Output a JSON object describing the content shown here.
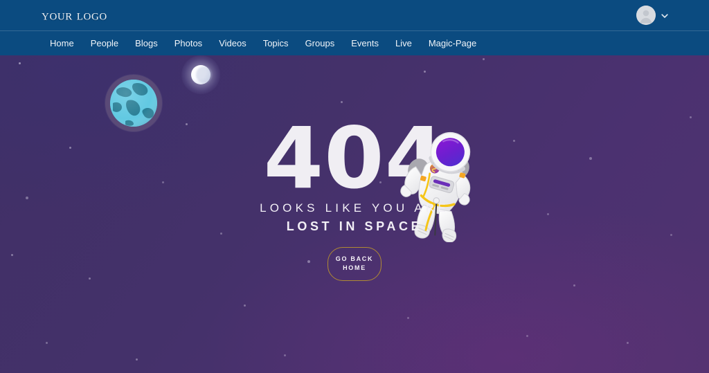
{
  "brand": {
    "logo_text": "Your logo",
    "account_icon": "user-avatar-placeholder",
    "chevron_icon": "chevron-down-icon"
  },
  "nav": {
    "items": [
      {
        "label": "Home"
      },
      {
        "label": "People"
      },
      {
        "label": "Blogs"
      },
      {
        "label": "Photos"
      },
      {
        "label": "Videos"
      },
      {
        "label": "Topics"
      },
      {
        "label": "Groups"
      },
      {
        "label": "Events"
      },
      {
        "label": "Live"
      },
      {
        "label": "Magic-Page"
      }
    ]
  },
  "hero": {
    "error_code": "404",
    "tagline_line1": "LOOKS LIKE YOU ARE",
    "tagline_line2": "LOST IN SPACE",
    "button_line1": "GO BACK",
    "button_line2": "HOME",
    "illustrations": {
      "earth": "earth-planet-icon",
      "moon": "moon-icon",
      "astronaut": "astronaut-illustration"
    }
  },
  "colors": {
    "navbar_blue": "#0b4b80",
    "space_purple_top_left": "#403066",
    "space_purple_bottom_right": "#50336f",
    "text_white": "#f0eef3",
    "button_gold": "#b08b33",
    "earth_ocean": "#62c9e2",
    "earth_land": "#2a7f96",
    "visor_purple": "#7a1fc6",
    "suit_white": "#f2f2f4",
    "accent_yellow": "#f5c518"
  }
}
